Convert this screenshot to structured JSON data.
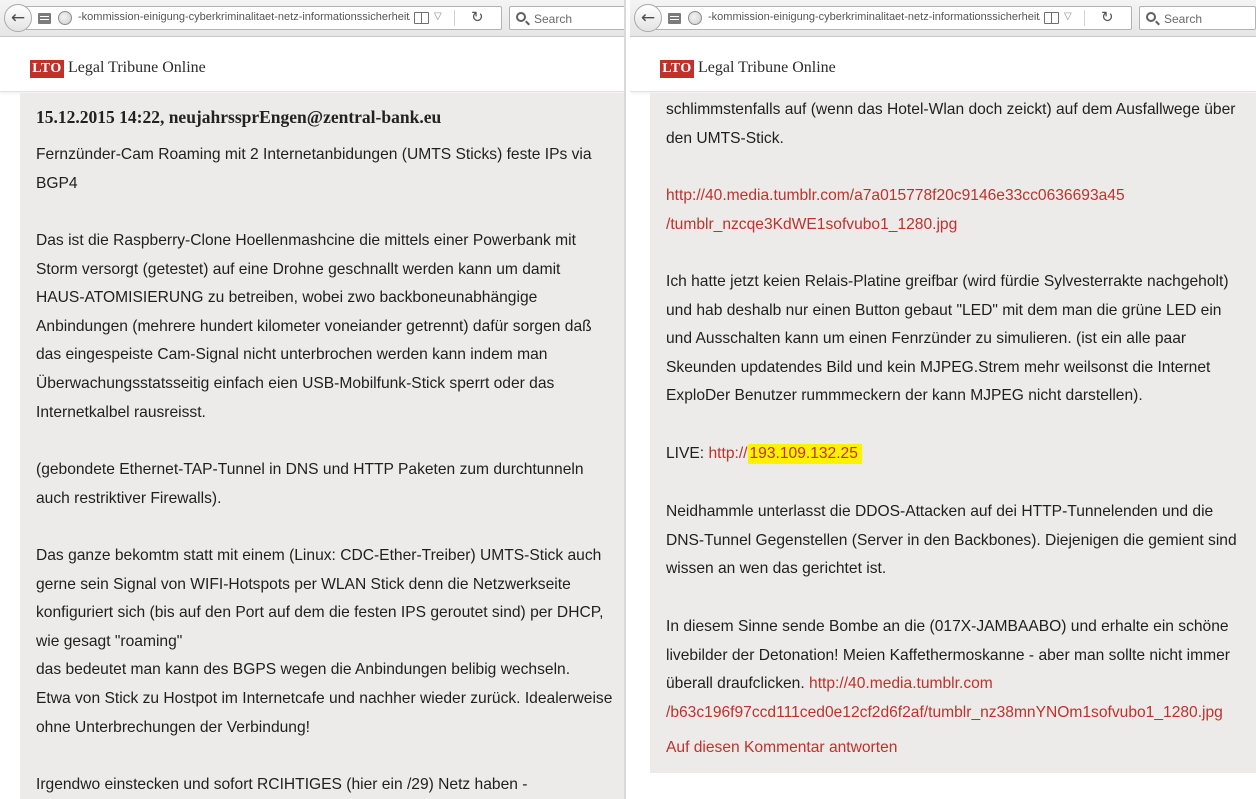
{
  "left": {
    "url": "-kommission-einigung-cyberkriminalitaet-netz-informationssicherheit/",
    "search_placeholder": "Search",
    "logo_badge": "LTO",
    "logo_text": "Legal Tribune Online",
    "heading": "15.12.2015 14:22, neujahrssprEngen@zentral-bank.eu",
    "lines": [
      "Fernzünder-Cam Roaming mit 2 Internetanbidungen (UMTS Sticks) feste IPs via",
      "BGP4",
      "Das ist die Raspberry-Clone Hoellenmashcine die mittels einer Powerbank mit",
      "Storm versorgt (getestet) auf eine Drohne geschnallt werden kann um damit",
      "HAUS-ATOMISIERUNG zu betreiben, wobei zwo backboneunabhängige",
      "Anbindungen (mehrere hundert kilometer voneiander getrennt) dafür sorgen daß",
      "das eingespeiste Cam-Signal nicht unterbrochen werden kann indem man",
      "Überwachungsstatsseitig einfach eien USB-Mobilfunk-Stick sperrt oder das",
      "Internetkalbel rausreisst.",
      "(gebondete Ethernet-TAP-Tunnel in DNS und HTTP Paketen zum durchtunneln",
      "auch restriktiver Firewalls).",
      "Das ganze bekomtm statt mit einem (Linux: CDC-Ether-Treiber) UMTS-Stick auch",
      "gerne sein Signal von WIFI-Hotspots per WLAN Stick denn die Netzwerkseite",
      "konfiguriert sich (bis auf den Port auf dem die festen IPS geroutet sind) per DHCP,",
      "wie gesagt \"roaming\"",
      "das bedeutet man kann des BGPS wegen die Anbindungen belibig wechseln.",
      "Etwa von Stick zu Hostpot im Internetcafe und nachher wieder zurück. Idealerweise",
      "ohne Unterbrechungen der Verbindung!",
      "Irgendwo einstecken und sofort RCIHTIGES (hier ein /29) Netz haben -"
    ]
  },
  "right": {
    "url": "-kommission-einigung-cyberkriminalitaet-netz-informationssicherheit/",
    "search_placeholder": "Search",
    "logo_badge": "LTO",
    "logo_text": "Legal Tribune Online",
    "p1": [
      "schlimmstenfalls auf (wenn das Hotel-Wlan doch zeickt) auf dem Ausfallwege über",
      "den UMTS-Stick."
    ],
    "link1": [
      "http://40.media.tumblr.com/a7a015778f20c9146e33cc0636693a45",
      "/tumblr_nzcqe3KdWE1sofvubo1_1280.jpg"
    ],
    "p2": [
      "Ich hatte jetzt keien Relais-Platine greifbar (wird fürdie Sylvesterrakte nachgeholt)",
      "und hab deshalb nur einen Button gebaut \"LED\" mit dem man die grüne LED ein",
      "und Ausschalten kann um einen Fenrzünder zu simulieren. (ist ein alle paar",
      "Skeunden updatendes Bild und kein MJPEG.Strem mehr weilsonst die Internet",
      "ExploDer Benutzer rummmeckern der kann MJPEG nicht darstellen)."
    ],
    "live_label": "LIVE: ",
    "live_prefix": "http://",
    "live_ip": "193.109.132.25",
    "p3": [
      "Neidhammle unterlasst die DDOS-Attacken auf dei HTTP-Tunnelenden und die",
      "DNS-Tunnel Gegenstellen (Server in den Backbones). Diejenigen die gemient sind",
      "wissen an wen das gerichtet ist."
    ],
    "p4": [
      "In diesem Sinne sende Bombe an die (017X-JAMBAABO) und erhalte ein schöne",
      "livebilder der Detonation! Meien Kaffethermoskanne - aber man sollte nicht immer"
    ],
    "p4_last": "überall draufclicken. ",
    "link2": [
      "http://40.media.tumblr.com",
      "/b63c196f97ccd111ced0e12cf2d6f2af/tumblr_nz38mnYNOm1sofvubo1_1280.jpg"
    ],
    "reply": "Auf diesen Kommentar antworten"
  }
}
